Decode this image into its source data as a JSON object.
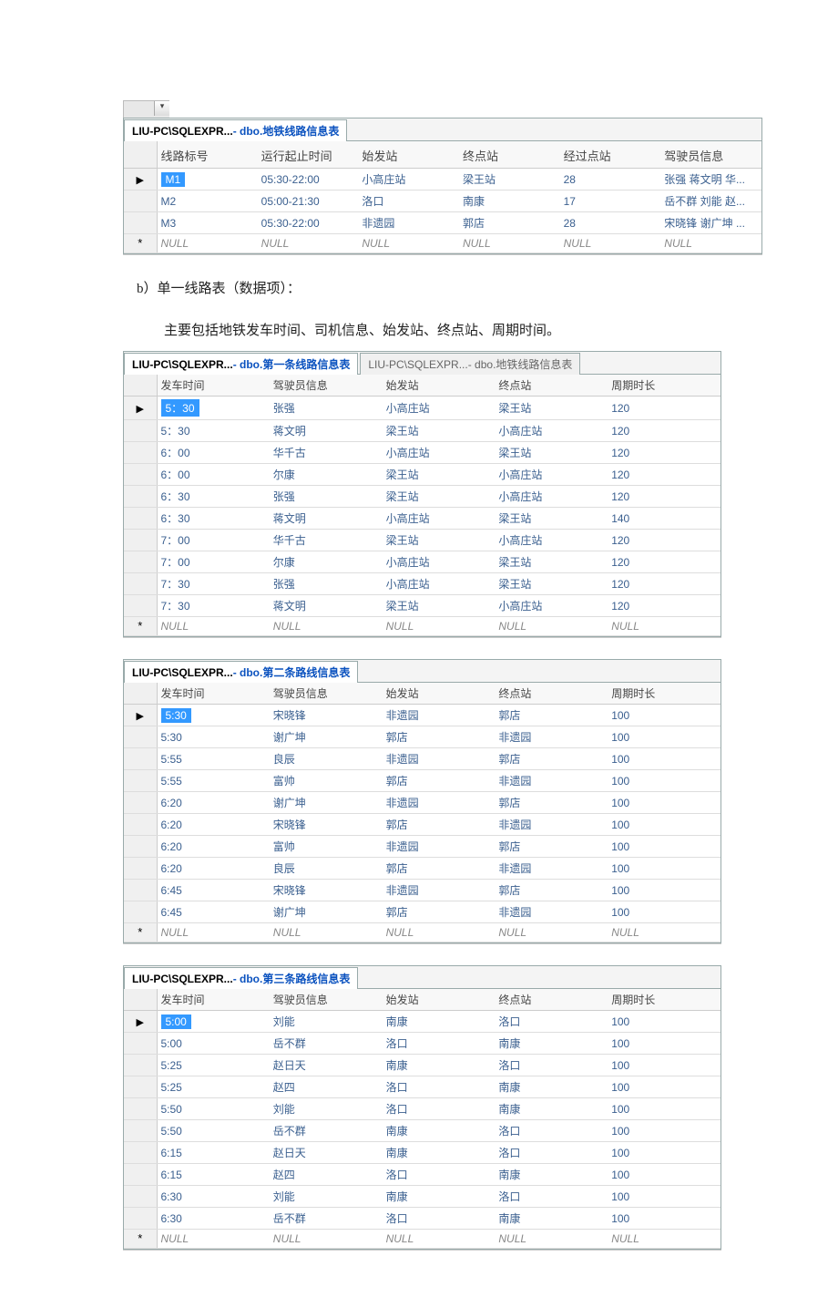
{
  "chrome_dd_glyph": "▾",
  "frame1": {
    "tab_pre": "LIU-PC\\SQLEXPR...",
    "tab_suf": " - dbo.地铁线路信息表",
    "headers": [
      "线路标号",
      "运行起止时间",
      "始发站",
      "终点站",
      "经过点站",
      "驾驶员信息"
    ],
    "rows": [
      {
        "marker": "▶",
        "cells": [
          "M1",
          "05:30-22:00",
          "小高庄站",
          "梁王站",
          "28",
          "张强 蒋文明 华..."
        ],
        "selected": true
      },
      {
        "marker": "",
        "cells": [
          "M2",
          "05:00-21:30",
          "洛口",
          "南康",
          "17",
          "岳不群 刘能 赵..."
        ]
      },
      {
        "marker": "",
        "cells": [
          "M3",
          "05:30-22:00",
          "非遗园",
          "郭店",
          "28",
          "宋晓锋 谢广坤 ..."
        ]
      },
      {
        "marker": "*",
        "cells": [
          "NULL",
          "NULL",
          "NULL",
          "NULL",
          "NULL",
          "NULL"
        ],
        "null": true
      }
    ]
  },
  "para_b": "b）单一线路表（数据项）：",
  "para_b2": "主要包括地铁发车时间、司机信息、始发站、终点站、周期时间。",
  "frame2": {
    "tab_active_pre": "LIU-PC\\SQLEXPR...",
    "tab_active_suf": " - dbo.第一条线路信息表",
    "tab_inactive_pre": "LIU-PC\\SQLEXPR...",
    "tab_inactive_suf": " - dbo.地铁线路信息表",
    "headers": [
      "发车时间",
      "驾驶员信息",
      "始发站",
      "终点站",
      "周期时长"
    ],
    "rows": [
      {
        "marker": "▶",
        "cells": [
          "5：30",
          "张强",
          "小高庄站",
          "梁王站",
          "120"
        ],
        "selected": true
      },
      {
        "marker": "",
        "cells": [
          "5：30",
          "蒋文明",
          "梁王站",
          "小高庄站",
          "120"
        ]
      },
      {
        "marker": "",
        "cells": [
          "6：00",
          "华千古",
          "小高庄站",
          "梁王站",
          "120"
        ]
      },
      {
        "marker": "",
        "cells": [
          "6：00",
          "尔康",
          "梁王站",
          "小高庄站",
          "120"
        ]
      },
      {
        "marker": "",
        "cells": [
          "6：30",
          "张强",
          "梁王站",
          "小高庄站",
          "120"
        ]
      },
      {
        "marker": "",
        "cells": [
          "6：30",
          "蒋文明",
          "小高庄站",
          "梁王站",
          "140"
        ]
      },
      {
        "marker": "",
        "cells": [
          "7：00",
          "华千古",
          "梁王站",
          "小高庄站",
          "120"
        ]
      },
      {
        "marker": "",
        "cells": [
          "7：00",
          "尔康",
          "小高庄站",
          "梁王站",
          "120"
        ]
      },
      {
        "marker": "",
        "cells": [
          "7：30",
          "张强",
          "小高庄站",
          "梁王站",
          "120"
        ]
      },
      {
        "marker": "",
        "cells": [
          "7：30",
          "蒋文明",
          "梁王站",
          "小高庄站",
          "120"
        ]
      },
      {
        "marker": "*",
        "cells": [
          "NULL",
          "NULL",
          "NULL",
          "NULL",
          "NULL"
        ],
        "null": true
      }
    ]
  },
  "frame3": {
    "tab_pre": "LIU-PC\\SQLEXPR...",
    "tab_suf": " - dbo.第二条路线信息表",
    "headers": [
      "发车时间",
      "驾驶员信息",
      "始发站",
      "终点站",
      "周期时长"
    ],
    "rows": [
      {
        "marker": "▶",
        "cells": [
          "5:30",
          "宋晓锋",
          "非遗园",
          "郭店",
          "100"
        ],
        "selected": true
      },
      {
        "marker": "",
        "cells": [
          "5:30",
          "谢广坤",
          "郭店",
          "非遗园",
          "100"
        ]
      },
      {
        "marker": "",
        "cells": [
          "5:55",
          "良辰",
          "非遗园",
          "郭店",
          "100"
        ]
      },
      {
        "marker": "",
        "cells": [
          "5:55",
          "富帅",
          "郭店",
          "非遗园",
          "100"
        ]
      },
      {
        "marker": "",
        "cells": [
          "6:20",
          "谢广坤",
          "非遗园",
          "郭店",
          "100"
        ]
      },
      {
        "marker": "",
        "cells": [
          "6:20",
          "宋晓锋",
          "郭店",
          "非遗园",
          "100"
        ]
      },
      {
        "marker": "",
        "cells": [
          "6:20",
          "富帅",
          "非遗园",
          "郭店",
          "100"
        ]
      },
      {
        "marker": "",
        "cells": [
          "6:20",
          "良辰",
          "郭店",
          "非遗园",
          "100"
        ]
      },
      {
        "marker": "",
        "cells": [
          "6:45",
          "宋晓锋",
          "非遗园",
          "郭店",
          "100"
        ]
      },
      {
        "marker": "",
        "cells": [
          "6:45",
          "谢广坤",
          "郭店",
          "非遗园",
          "100"
        ]
      },
      {
        "marker": "*",
        "cells": [
          "NULL",
          "NULL",
          "NULL",
          "NULL",
          "NULL"
        ],
        "null": true
      }
    ]
  },
  "frame4": {
    "tab_pre": "LIU-PC\\SQLEXPR...",
    "tab_suf": " - dbo.第三条路线信息表",
    "headers": [
      "发车时间",
      "驾驶员信息",
      "始发站",
      "终点站",
      "周期时长"
    ],
    "rows": [
      {
        "marker": "▶",
        "cells": [
          "5:00",
          "刘能",
          "南康",
          "洛口",
          "100"
        ],
        "selected": true
      },
      {
        "marker": "",
        "cells": [
          "5:00",
          "岳不群",
          "洛口",
          "南康",
          "100"
        ]
      },
      {
        "marker": "",
        "cells": [
          "5:25",
          "赵日天",
          "南康",
          "洛口",
          "100"
        ]
      },
      {
        "marker": "",
        "cells": [
          "5:25",
          "赵四",
          "洛口",
          "南康",
          "100"
        ]
      },
      {
        "marker": "",
        "cells": [
          "5:50",
          "刘能",
          "洛口",
          "南康",
          "100"
        ]
      },
      {
        "marker": "",
        "cells": [
          "5:50",
          "岳不群",
          "南康",
          "洛口",
          "100"
        ]
      },
      {
        "marker": "",
        "cells": [
          "6:15",
          "赵日天",
          "南康",
          "洛口",
          "100"
        ]
      },
      {
        "marker": "",
        "cells": [
          "6:15",
          "赵四",
          "洛口",
          "南康",
          "100"
        ]
      },
      {
        "marker": "",
        "cells": [
          "6:30",
          "刘能",
          "南康",
          "洛口",
          "100"
        ]
      },
      {
        "marker": "",
        "cells": [
          "6:30",
          "岳不群",
          "洛口",
          "南康",
          "100"
        ]
      },
      {
        "marker": "*",
        "cells": [
          "NULL",
          "NULL",
          "NULL",
          "NULL",
          "NULL"
        ],
        "null": true
      }
    ]
  }
}
